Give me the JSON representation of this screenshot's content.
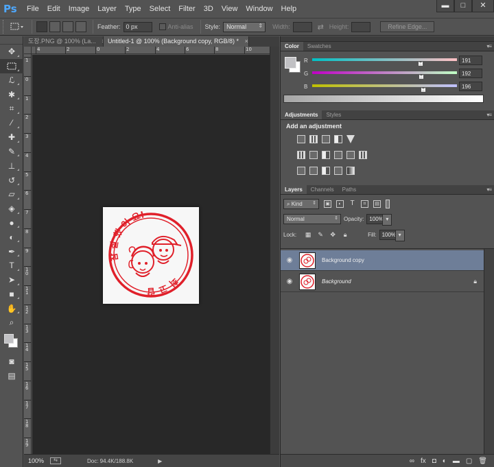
{
  "app": {
    "logo": "Ps"
  },
  "menu": [
    "File",
    "Edit",
    "Image",
    "Layer",
    "Type",
    "Select",
    "Filter",
    "3D",
    "View",
    "Window",
    "Help"
  ],
  "window_controls": {
    "minimize": "▬",
    "maximize": "□",
    "close": "✕"
  },
  "options": {
    "feather_label": "Feather:",
    "feather_value": "0 px",
    "antialias_label": "Anti-alias",
    "style_label": "Style:",
    "style_value": "Normal",
    "width_label": "Width:",
    "height_label": "Height:",
    "refine_edge": "Refine Edge..."
  },
  "tabs": [
    {
      "title": "도장.PNG @ 100% (La...",
      "close": "×"
    },
    {
      "title": "Untitled-1 @ 100% (Background copy, RGB/8) *",
      "close": "×"
    }
  ],
  "ruler": {
    "h_labels": [
      "4",
      "2",
      "0",
      "2",
      "4",
      "6",
      "8",
      "10"
    ],
    "v_labels": [
      "1",
      "0",
      "1",
      "2",
      "3",
      "4",
      "5",
      "6",
      "7",
      "8",
      "9",
      "1 0",
      "1 1",
      "1 2",
      "1 3",
      "1 4",
      "1 5",
      "1 6",
      "1 7",
      "1 8",
      "1 9"
    ]
  },
  "status": {
    "zoom": "100%",
    "doc": "Doc: 94.4K/188.8K"
  },
  "color_panel": {
    "tabs": [
      "Color",
      "Swatches"
    ],
    "channels": [
      {
        "label": "R",
        "value": "191",
        "fraction": 0.749
      },
      {
        "label": "G",
        "value": "192",
        "fraction": 0.753
      },
      {
        "label": "B",
        "value": "196",
        "fraction": 0.769
      }
    ],
    "foreground": "#bfc0c4",
    "background": "#ffffff"
  },
  "adjustments": {
    "tabs": [
      "Adjustments",
      "Styles"
    ],
    "title": "Add an adjustment"
  },
  "layers": {
    "tabs": [
      "Layers",
      "Channels",
      "Paths"
    ],
    "kind_label": "Kind",
    "blend_mode": "Normal",
    "opacity_label": "Opacity:",
    "opacity_value": "100%",
    "lock_label": "Lock:",
    "fill_label": "Fill:",
    "fill_value": "100%",
    "items": [
      {
        "name": "Background copy",
        "selected": true,
        "locked": false
      },
      {
        "name": "Background",
        "selected": false,
        "locked": true
      }
    ]
  },
  "stamp": {
    "color": "#e0202a",
    "top_text": "참 잘 했 어 요!",
    "bottom_text": "최 고 랍 니 다"
  }
}
